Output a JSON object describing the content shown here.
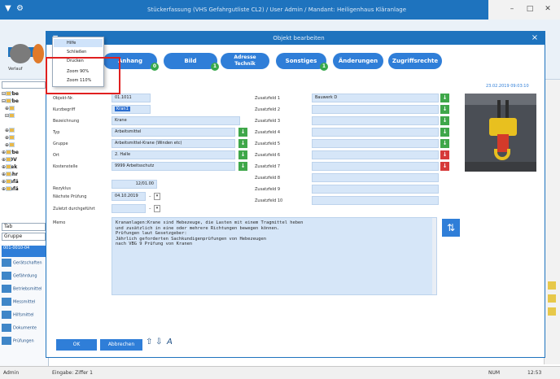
{
  "window": {
    "title": "Stückerfassung (VHS Gefahrgutliste CL2) / User Admin / Mandant: Heiligenhaus Kläranlage"
  },
  "ribbon": {
    "tab_label": "Liste",
    "items": [
      {
        "label": "Verlauf",
        "color": "#7b7b7b"
      },
      {
        "label": "Dokumente",
        "color": "#e07a2a"
      }
    ]
  },
  "tree": {
    "rows": [
      "Arbe",
      "Arbe",
      "A",
      "A",
      "A",
      "A",
      "A",
      "Arbe",
      "EDV",
      "Elek",
      "Fahr",
      "Gefä",
      "Gefä"
    ],
    "search1_placeholder": "Tab",
    "search2_placeholder": "Gruppe"
  },
  "sidelist": {
    "header": "001-0010-04",
    "items": [
      "Gerätschaften",
      "Gefährdung",
      "Betriebsmittel",
      "Messmittel",
      "Hilfsmittel",
      "Dokumente",
      "Prüfungen"
    ]
  },
  "statusbar": {
    "left": "Admin",
    "mid": "Eingabe: Ziffer 1",
    "right_a": "NUM",
    "right_b": "12:53"
  },
  "dialog": {
    "title": "Objekt bearbeiten",
    "close": "×",
    "menu_icon": "▼",
    "tabs": [
      {
        "label": "Anhang",
        "badge": "0"
      },
      {
        "label": "Bild",
        "badge": "1"
      },
      {
        "label": "Adresse\nTechnik",
        "badge": ""
      },
      {
        "label": "Sonstiges",
        "badge": "1"
      },
      {
        "label": "Änderungen",
        "badge": ""
      },
      {
        "label": "Zugriffsrechte",
        "badge": ""
      }
    ],
    "date_stamp": "23.02.2019 09:03:10",
    "left_fields": [
      {
        "label": "Objekt-Nr.",
        "value": "01.1011"
      },
      {
        "label": "Kurzbegriff",
        "value": "Kran1"
      },
      {
        "label": "Bezeichnung",
        "value": "Krane"
      },
      {
        "label": "Typ",
        "value": "Arbeitsmittel"
      },
      {
        "label": "Gruppe",
        "value": "Arbeitsmittel-Krane (Winden etc)"
      },
      {
        "label": "Ort",
        "value": "2. Halle"
      },
      {
        "label": "Kostenstelle",
        "value": "9999 Arbeitsschutz"
      }
    ],
    "inspection": {
      "interval_label": "Rezyklus",
      "interval_value": "12/01.00",
      "next_label": "Nächste Prüfung",
      "next_value": "04.10.2019",
      "done_label": "Zuletzt durchgeführt",
      "done_value": ""
    },
    "extra_fields": [
      {
        "label": "Zusatzfeld 1",
        "value": "Bauwerk D"
      },
      {
        "label": "Zusatzfeld 2",
        "value": ""
      },
      {
        "label": "Zusatzfeld 3",
        "value": ""
      },
      {
        "label": "Zusatzfeld 4",
        "value": ""
      },
      {
        "label": "Zusatzfeld 5",
        "value": ""
      },
      {
        "label": "Zusatzfeld 6",
        "value": ""
      },
      {
        "label": "Zusatzfeld 7",
        "value": ""
      },
      {
        "label": "Zusatzfeld 8",
        "value": ""
      },
      {
        "label": "Zusatzfeld 9",
        "value": ""
      },
      {
        "label": "Zusatzfeld 10",
        "value": ""
      }
    ],
    "memo_label": "Memo",
    "memo_text": "Krananlagen:Krane sind Hebezeuge, die Lasten mit einem Tragmittel heben\nund zusätzlich in eine oder mehrere Richtungen bewegen können.\nPrüfungen laut Gesetzgeber:\nJährlich geforderten Sachkundigenprüfungen von Hebezeugen\nnach VBG 9 Prüfung von Kranen",
    "ok_label": "OK",
    "cancel_label": "Abbrechen",
    "sort_icon": "⇅",
    "upload_icon": "⇧",
    "download_icon": "⇩",
    "aa_icon": "A"
  },
  "menu": {
    "items": [
      "Hilfe",
      "Schließen",
      "Drucken",
      "Zoom 90%",
      "Zoom 110%"
    ]
  },
  "colors": {
    "accent": "#1e73be",
    "tab": "#2f7ed8",
    "field": "#d6e6f8",
    "green": "#3fa74a",
    "red": "#d63a3a",
    "highlight": "#e02020"
  }
}
